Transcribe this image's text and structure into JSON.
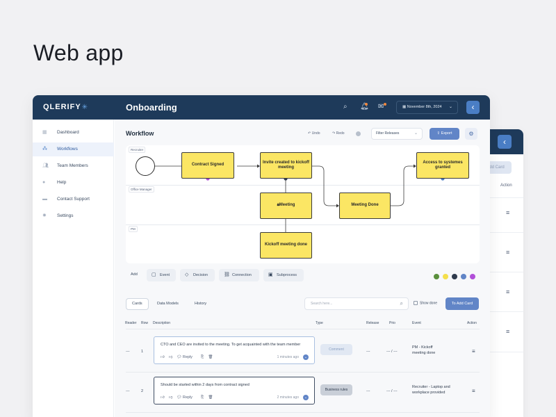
{
  "headline": "Web app",
  "app": {
    "logo": "QLERIFY",
    "page_title": "Onboarding",
    "date": "November 8th, 2024",
    "icons": {
      "search": "search-icon",
      "notifications": "bell-icon",
      "messages": "mail-icon",
      "back": "chevron-left-icon"
    }
  },
  "sidebar": {
    "items": [
      {
        "label": "Dashboard",
        "icon": "dashboard-icon"
      },
      {
        "label": "Workflows",
        "icon": "workflows-icon",
        "active": true
      },
      {
        "label": "Team Members",
        "icon": "team-icon"
      },
      {
        "label": "Help",
        "icon": "help-icon"
      },
      {
        "label": "Contact Support",
        "icon": "support-icon"
      },
      {
        "label": "Settings",
        "icon": "settings-icon"
      }
    ]
  },
  "workflow": {
    "title": "Workflow",
    "undo": "Undo",
    "redo": "Redo",
    "filter": "Filter Releases",
    "export": "Export",
    "lanes": [
      "Recruiter",
      "Office Manager",
      "PM"
    ],
    "nodes": {
      "contract_signed": "Contract Signed",
      "invite_created": "Invite created to kickoff meeting",
      "access_granted": "Access to systemes granted",
      "meeting": "Meeting",
      "meeting_done": "Meeting Done",
      "kickoff_done": "Kickoff meeting done"
    }
  },
  "toolbar": {
    "add_label": "Add",
    "event": "Event",
    "decision": "Decision",
    "connection": "Connection",
    "subprocess": "Subprocess"
  },
  "colors": {
    "accent": "#6185c7",
    "topbar": "#1e3a5a",
    "node": "#fbe664",
    "swatches": [
      "#5a8f3c",
      "#f4df4c",
      "#2f3b4d",
      "#6185c7",
      "#b14fd8"
    ]
  },
  "tabs": {
    "cards": "Cards",
    "data_models": "Data Models",
    "history": "History"
  },
  "search": {
    "placeholder": "Search here..."
  },
  "show_done": "Show done",
  "add_card": "To Add Card",
  "background_window": {
    "add_card": "Add Card",
    "action": "Action"
  },
  "table": {
    "headers": {
      "reader": "Reader",
      "row": "Row",
      "description": "Description",
      "type": "Type",
      "release": "Release",
      "prio": "Prio",
      "event": "Event",
      "action": "Action"
    },
    "rows": [
      {
        "reader": "---",
        "row": "1",
        "description": "CTO and CEO are invited to the meeting. To get acquainted with the team member",
        "reply": "Reply",
        "time": "1 minutes ago",
        "type": "Comment",
        "release": "---",
        "prio": "--- / ---",
        "event_l1": "PM - Kickoff",
        "event_l2": "meeting done"
      },
      {
        "reader": "---",
        "row": "2",
        "description": "Should be started within 2 days from contract signed",
        "reply": "Reply",
        "time": "2 minutes ago",
        "type": "Business rules",
        "release": "---",
        "prio": "--- / ---",
        "event_l1": "Recruiter - Laptop and",
        "event_l2": "workplace provided"
      }
    ]
  }
}
